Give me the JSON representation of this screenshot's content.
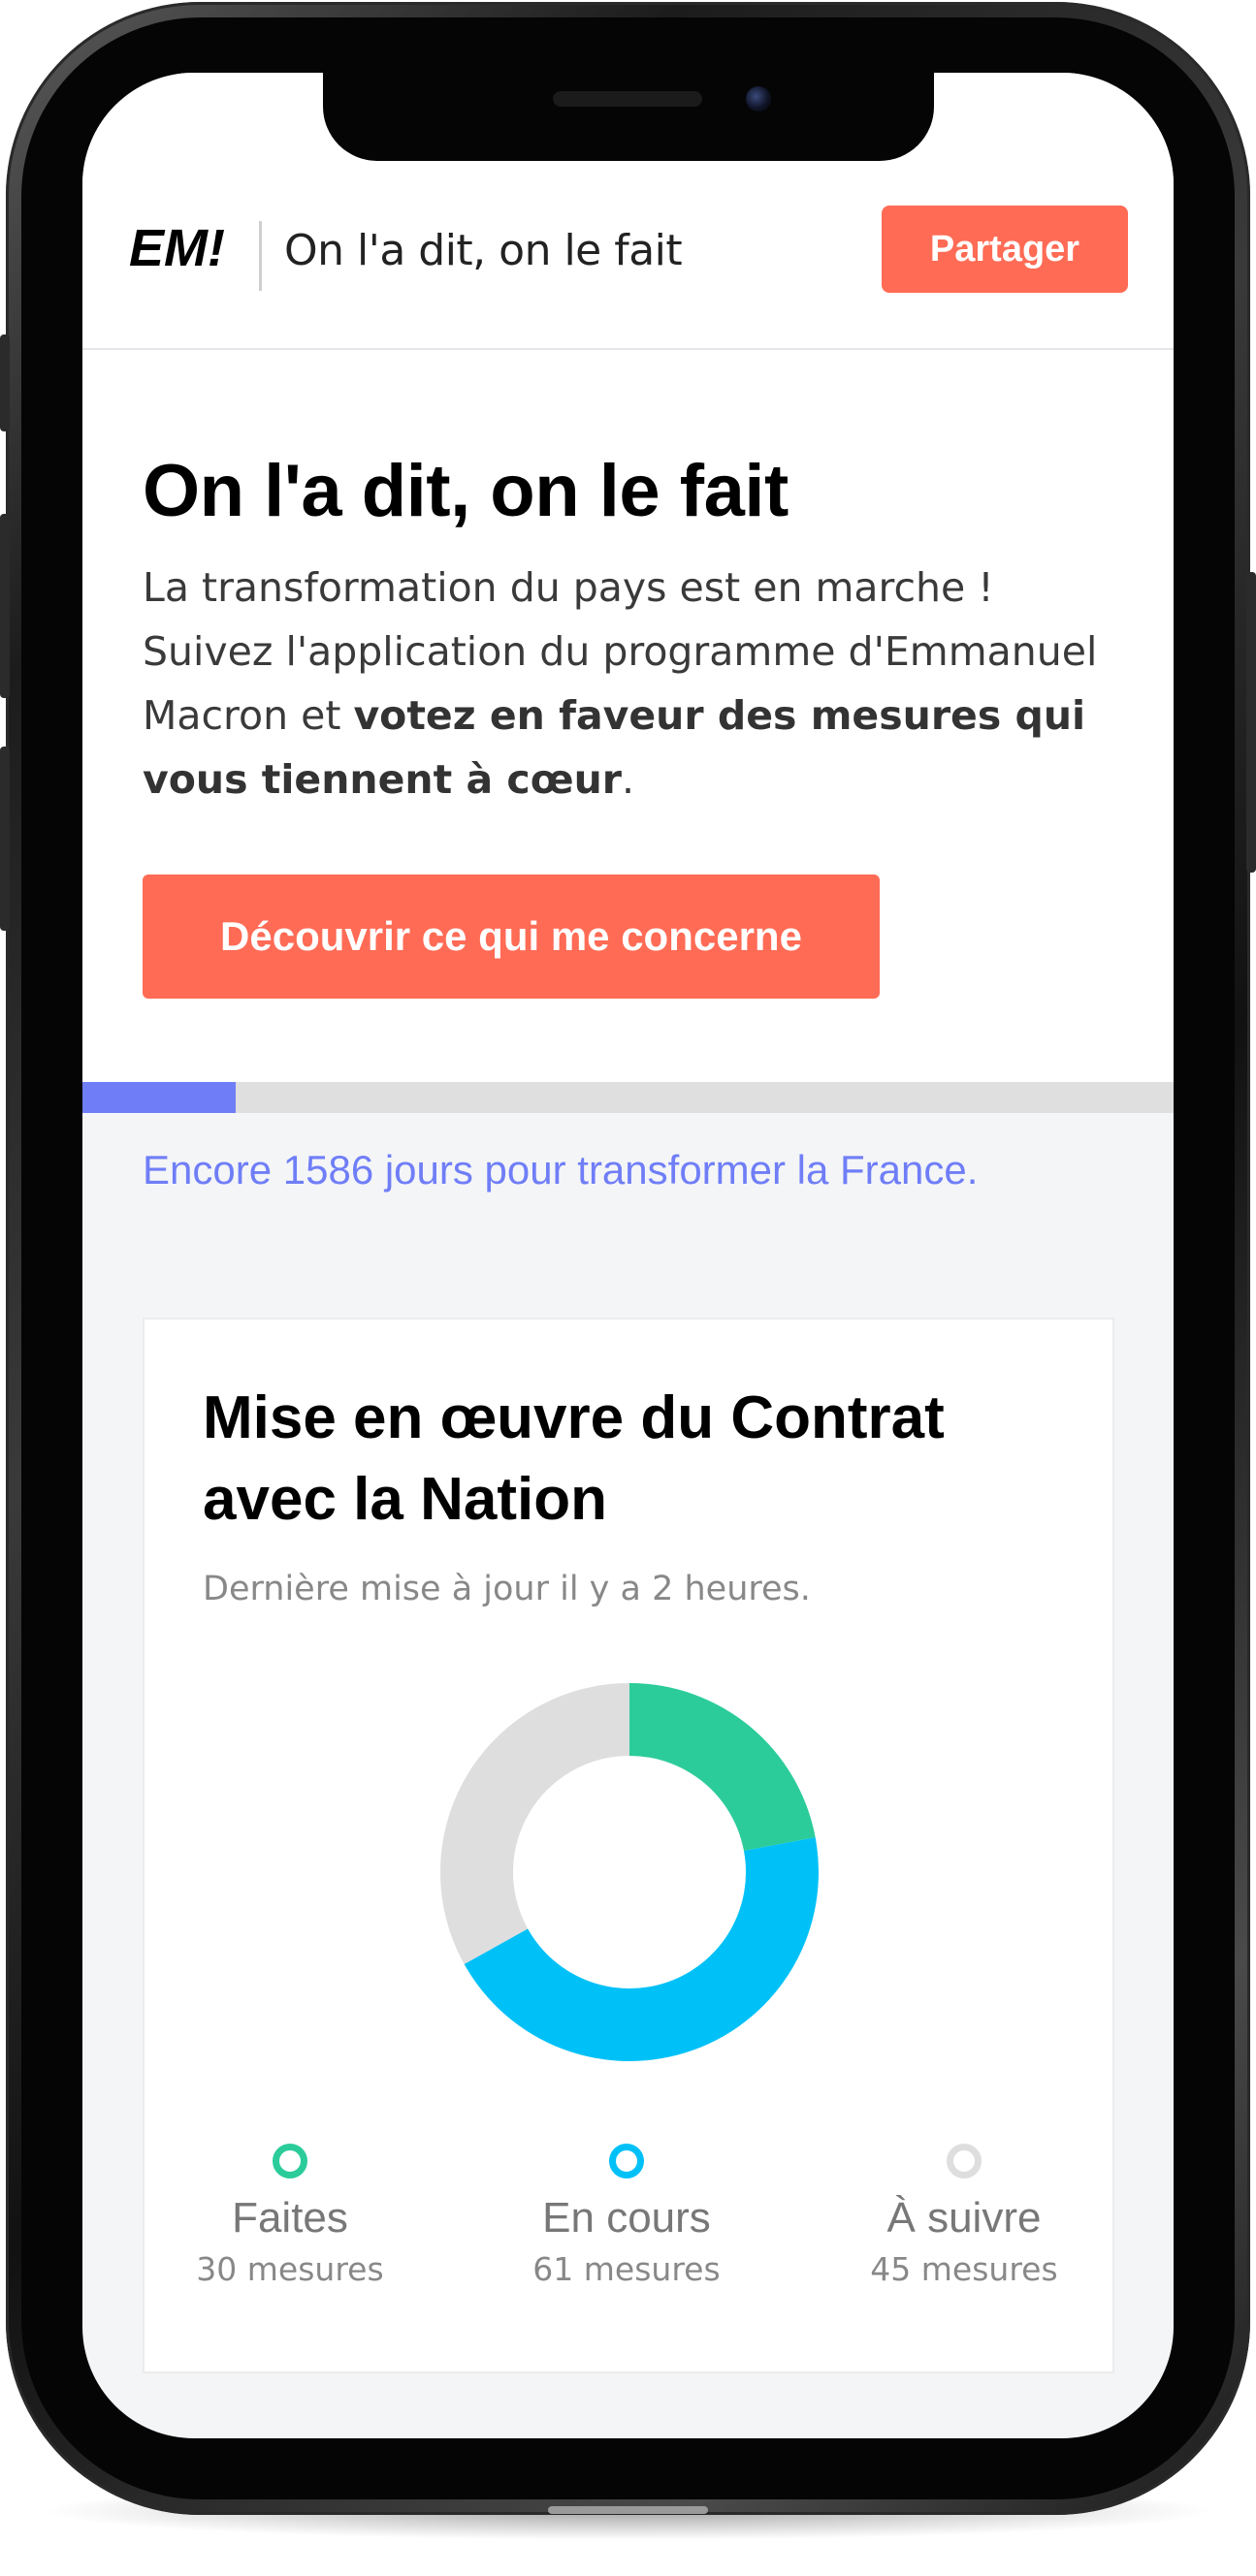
{
  "header": {
    "logo": "EM!",
    "tagline": "On l'a dit, on le fait",
    "share_label": "Partager"
  },
  "hero": {
    "title": "On l'a dit, on le fait",
    "text_intro": "La transformation du pays est en marche ! Suivez l'application du programme d'Emmanuel Macron et ",
    "text_bold": "votez en faveur des mesures qui vous tiennent à cœur",
    "text_end": ".",
    "cta_label": "Découvrir ce qui me concerne"
  },
  "progress": {
    "fraction": 0.14,
    "days_left_text": "Encore 1586 jours pour transformer la France."
  },
  "card": {
    "title": "Mise en œuvre du Contrat avec la Nation",
    "subtitle": "Dernière mise à jour il y a 2 heures."
  },
  "colors": {
    "accent": "#ff6b55",
    "progress": "#6f7ef7",
    "done": "#2ccc9a",
    "in_progress": "#00c1f7",
    "to_follow": "#dedede"
  },
  "chart_data": {
    "type": "pie",
    "categories": [
      "Faites",
      "En cours",
      "À suivre"
    ],
    "values": [
      30,
      61,
      45
    ],
    "labels": [
      "30 mesures",
      "61 mesures",
      "45 mesures"
    ],
    "colors": [
      "#2ccc9a",
      "#00c1f7",
      "#dedede"
    ]
  }
}
